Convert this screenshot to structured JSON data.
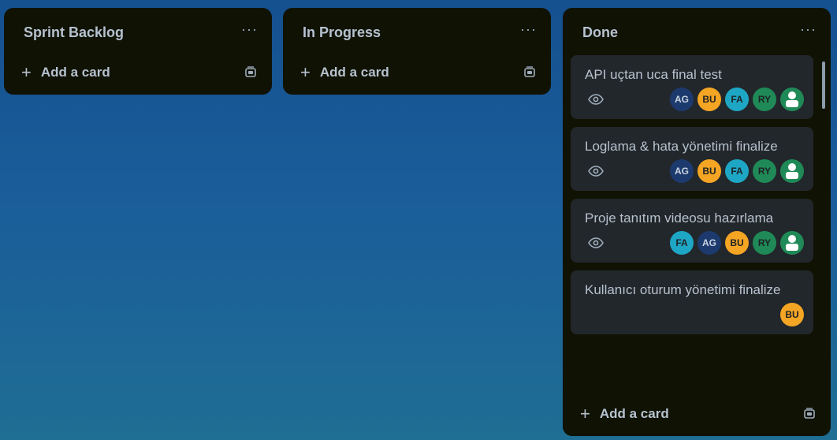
{
  "add_card_label": "Add a card",
  "more_glyph": "···",
  "lists": [
    {
      "title": "Sprint Backlog"
    },
    {
      "title": "In Progress"
    },
    {
      "title": "Done"
    }
  ],
  "done_cards": [
    {
      "title": "API uçtan uca final test",
      "watched": true,
      "members": [
        "AG",
        "BU",
        "FA",
        "RY",
        "user-icon"
      ]
    },
    {
      "title": "Loglama & hata yönetimi finalize",
      "watched": true,
      "members": [
        "AG",
        "BU",
        "FA",
        "RY",
        "user-icon"
      ]
    },
    {
      "title": "Proje tanıtım videosu hazırlama",
      "watched": true,
      "members": [
        "FA",
        "AG",
        "BU",
        "RY",
        "user-icon"
      ]
    },
    {
      "title": "Kullanıcı oturum yönetimi finalize",
      "watched": false,
      "members": [
        "BU"
      ]
    }
  ],
  "colors": {
    "AG": "#1d3a6e",
    "BU": "#f5a524",
    "FA": "#1ea7c5",
    "RY": "#1f8a57",
    "user-icon": "#1f8a57"
  }
}
